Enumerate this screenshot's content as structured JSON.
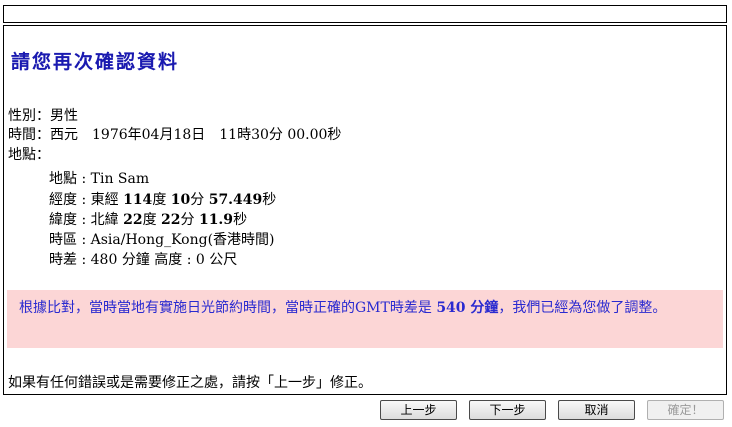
{
  "page": {
    "title": "請您再次確認資料"
  },
  "details": {
    "gender": "性別：男性",
    "time": "時間：西元　1976年04月18日　11時30分 00.00秒",
    "place_label": "地點："
  },
  "location": {
    "place_label": "地點",
    "place_value": "Tin Sam",
    "longitude_label": "經度",
    "longitude_dir": "東經",
    "longitude_deg": "114",
    "longitude_min": "10",
    "longitude_sec": "57.449",
    "latitude_label": "緯度",
    "latitude_dir": "北緯",
    "latitude_deg": "22",
    "latitude_min": "22",
    "latitude_sec": "11.9",
    "timezone_label": "時區",
    "timezone_value": "Asia/Hong_Kong(香港時間)",
    "offset_label": "時差",
    "offset_value": "480",
    "offset_unit": "分鐘",
    "altitude_label": "高度",
    "altitude_value": "0",
    "altitude_unit": "公尺"
  },
  "units": {
    "degree": "度",
    "minute": "分",
    "second": "秒"
  },
  "notice": {
    "text_before": "根據比對，當時當地有實施日光節約時間，當時正確的GMT時差是",
    "value": "540 分鐘",
    "text_after": "，我們已經為您做了調整。"
  },
  "footer": {
    "text": "如果有任何錯誤或是需要修正之處，請按「上一步」修正。"
  },
  "buttons": {
    "prev": "上一步",
    "next": "下一步",
    "cancel": "取消",
    "confirm": "確定！"
  },
  "colors": {
    "title": "#1a1ab0",
    "notice_bg": "#fcd6d6",
    "notice_text": "#2a2ad0"
  }
}
